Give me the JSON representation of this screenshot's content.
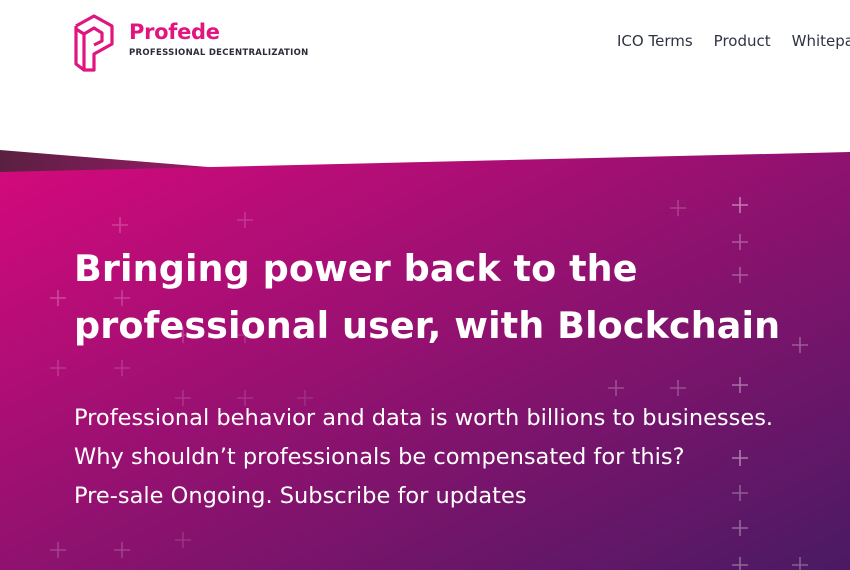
{
  "brand": {
    "name": "Profede",
    "tagline": "PROFESSIONAL DECENTRALIZATION",
    "color": "#e0157f"
  },
  "nav": {
    "items": [
      {
        "label": "ICO Terms"
      },
      {
        "label": "Product"
      },
      {
        "label": "Whitepa"
      }
    ]
  },
  "hero": {
    "headline_1": "Bringing power back to the",
    "headline_2": "professional user, with Blockchain",
    "sub_1": "Professional behavior and data is worth billions to businesses.",
    "sub_2": "Why shouldn’t professionals be compensated for this?",
    "sub_3": "Pre-sale Ongoing. Subscribe for updates",
    "gradient_start": "#d6097c",
    "gradient_end": "#4a1a63"
  }
}
